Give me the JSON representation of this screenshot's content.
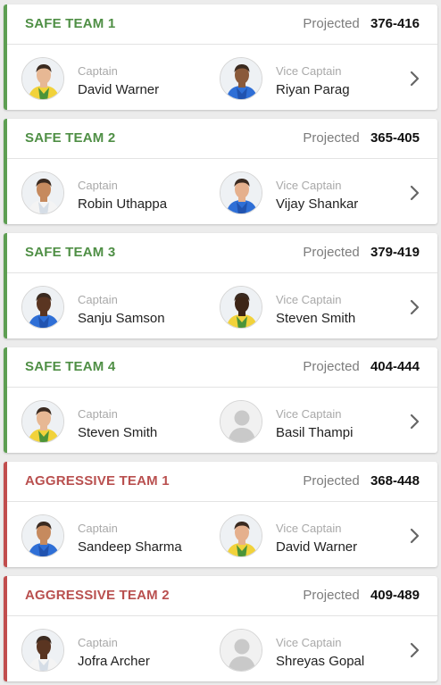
{
  "colors": {
    "safe_accent": "#5d9e52",
    "safe_text": "#4f8f45",
    "aggressive_accent": "#c14d4d",
    "aggressive_text": "#b9504f"
  },
  "projected_label": "Projected",
  "captain_label": "Captain",
  "vice_captain_label": "Vice Captain",
  "teams": [
    {
      "name": "SAFE TEAM 1",
      "kind": "safe",
      "projected": "376-416",
      "captain": {
        "name": "David Warner",
        "avatar": "player-photo-australia"
      },
      "vice_captain": {
        "name": "Riyan Parag",
        "avatar": "player-photo-india-blue"
      }
    },
    {
      "name": "SAFE TEAM 2",
      "kind": "safe",
      "projected": "365-405",
      "captain": {
        "name": "Robin Uthappa",
        "avatar": "player-photo-white-kit"
      },
      "vice_captain": {
        "name": "Vijay Shankar",
        "avatar": "player-photo-india-blue"
      }
    },
    {
      "name": "SAFE TEAM 3",
      "kind": "safe",
      "projected": "379-419",
      "captain": {
        "name": "Sanju Samson",
        "avatar": "player-photo-india-blue"
      },
      "vice_captain": {
        "name": "Steven Smith",
        "avatar": "player-photo-australia"
      }
    },
    {
      "name": "SAFE TEAM 4",
      "kind": "safe",
      "projected": "404-444",
      "captain": {
        "name": "Steven Smith",
        "avatar": "player-photo-australia"
      },
      "vice_captain": {
        "name": "Basil Thampi",
        "avatar": "placeholder-silhouette"
      }
    },
    {
      "name": "AGGRESSIVE TEAM 1",
      "kind": "aggressive",
      "projected": "368-448",
      "captain": {
        "name": "Sandeep Sharma",
        "avatar": "player-photo-india-blue"
      },
      "vice_captain": {
        "name": "David Warner",
        "avatar": "player-photo-australia"
      }
    },
    {
      "name": "AGGRESSIVE TEAM 2",
      "kind": "aggressive",
      "projected": "409-489",
      "captain": {
        "name": "Jofra Archer",
        "avatar": "player-photo-white-kit"
      },
      "vice_captain": {
        "name": "Shreyas Gopal",
        "avatar": "placeholder-silhouette"
      }
    }
  ],
  "icons": {
    "chevron": "chevron-right-icon"
  }
}
